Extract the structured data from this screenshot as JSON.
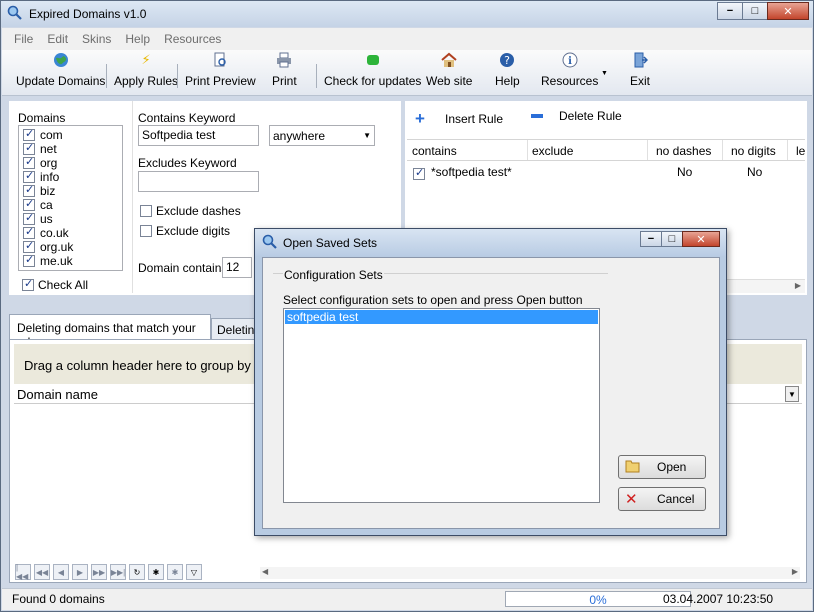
{
  "window": {
    "title": "Expired Domains v1.0"
  },
  "menu": [
    "File",
    "Edit",
    "Skins",
    "Help",
    "Resources"
  ],
  "toolbar": {
    "update": "Update Domains",
    "apply": "Apply Rules",
    "preview": "Print Preview",
    "print": "Print",
    "check": "Check for updates",
    "web": "Web site",
    "help": "Help",
    "resources": "Resources",
    "exit": "Exit"
  },
  "domains": {
    "label": "Domains",
    "items": [
      "com",
      "net",
      "org",
      "info",
      "biz",
      "ca",
      "us",
      "co.uk",
      "org.uk",
      "me.uk"
    ],
    "check_all": "Check All"
  },
  "filters": {
    "contains_label": "Contains Keyword",
    "contains_value": "Softpedia test",
    "position_value": "anywhere",
    "excludes_label": "Excludes Keyword",
    "excludes_value": "",
    "exclude_dashes": "Exclude dashes",
    "exclude_digits": "Exclude digits",
    "domain_contains_label": "Domain contains",
    "domain_contains_value": "12"
  },
  "rules": {
    "insert": "Insert Rule",
    "delete": "Delete Rule",
    "columns": [
      "contains",
      "exclude",
      "no dashes",
      "no digits",
      "le"
    ],
    "rows": [
      {
        "contains": "*softpedia test*",
        "exclude": "",
        "no_dashes": "No",
        "no_digits": "No"
      }
    ]
  },
  "tabs": {
    "tab1": "Deleting domains that match your rules",
    "tab2": "Deleting"
  },
  "grid": {
    "group_hint": "Drag a column header here to group by",
    "column": "Domain name"
  },
  "status": {
    "found": "Found 0 domains",
    "progress": "0%",
    "progress_value": 0,
    "datetime": "03.04.2007 10:23:50"
  },
  "dialog": {
    "title": "Open Saved Sets",
    "group": "Configuration Sets",
    "instruction": "Select configuration sets to open and press Open button",
    "items": [
      "softpedia test"
    ],
    "open": "Open",
    "cancel": "Cancel"
  },
  "colors": {
    "accent": "#3399ff",
    "selected": "#3399ff"
  }
}
